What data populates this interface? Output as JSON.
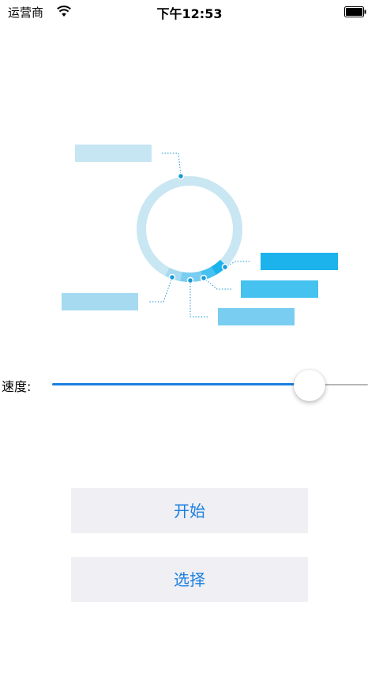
{
  "status_bar": {
    "carrier": "运营商",
    "wifi_icon": "wifi-icon",
    "time": "下午12:53",
    "battery_icon": "battery-icon"
  },
  "chart": {
    "ring_color": "#c9e6f3",
    "segment_colors": [
      "#1cb3ec",
      "#45c2ef",
      "#79cdf0",
      "#a5daf0"
    ],
    "label_box_colors": [
      "#c6e6f3",
      "#1cb3ec",
      "#45c2ef",
      "#79cdf0",
      "#a5daf0"
    ],
    "leader_color": "#1a9ad6"
  },
  "speed": {
    "label": "速度:",
    "value_fraction": 0.85,
    "min_color": "#1a7fe0",
    "max_color": "#b7b7b7"
  },
  "buttons": {
    "start_label": "开始",
    "select_label": "选择",
    "background": "#efeff4",
    "text_color": "#1a7fe0"
  }
}
